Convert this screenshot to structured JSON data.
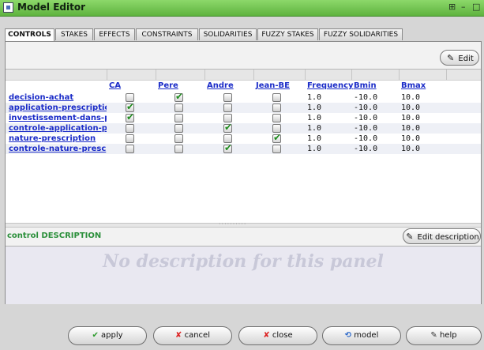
{
  "window": {
    "title": "Model Editor",
    "controls": [
      "⊞",
      "–",
      "□"
    ]
  },
  "tabs": [
    {
      "label": "CONTROLS",
      "active": true
    },
    {
      "label": "STAKES",
      "active": false
    },
    {
      "label": "EFFECTS",
      "active": false
    },
    {
      "label": "CONSTRAINTS",
      "active": false
    },
    {
      "label": "SOLIDARITIES",
      "active": false
    },
    {
      "label": "FUZZY STAKES",
      "active": false
    },
    {
      "label": "FUZZY SOLIDARITIES",
      "active": false
    }
  ],
  "toolbar": {
    "edit_label": "Edit"
  },
  "table": {
    "columns": [
      "CA",
      "Pere",
      "Andre",
      "Jean-BE",
      "Frequency",
      "Bmin",
      "Bmax"
    ],
    "rows": [
      {
        "name": "decision-achat",
        "checks": [
          false,
          true,
          false,
          false
        ],
        "frequency": "1.0",
        "bmin": "-10.0",
        "bmax": "10.0"
      },
      {
        "name": "application-prescription",
        "checks": [
          true,
          false,
          false,
          false
        ],
        "frequency": "1.0",
        "bmin": "-10.0",
        "bmax": "10.0"
      },
      {
        "name": "investissement-dans-pri",
        "checks": [
          true,
          false,
          false,
          false
        ],
        "frequency": "1.0",
        "bmin": "-10.0",
        "bmax": "10.0"
      },
      {
        "name": "controle-application-pre",
        "checks": [
          false,
          false,
          true,
          false
        ],
        "frequency": "1.0",
        "bmin": "-10.0",
        "bmax": "10.0"
      },
      {
        "name": "nature-prescription",
        "checks": [
          false,
          false,
          false,
          true
        ],
        "frequency": "1.0",
        "bmin": "-10.0",
        "bmax": "10.0"
      },
      {
        "name": "controle-nature-presc",
        "checks": [
          false,
          false,
          true,
          false
        ],
        "frequency": "1.0",
        "bmin": "-10.0",
        "bmax": "10.0"
      }
    ]
  },
  "description": {
    "label": "control DESCRIPTION",
    "edit_label": "Edit description",
    "placeholder": "No description for this panel"
  },
  "actions": [
    {
      "label": "apply",
      "icon": "checkmark-icon"
    },
    {
      "label": "cancel",
      "icon": "cross-icon"
    },
    {
      "label": "close",
      "icon": "cross-icon"
    },
    {
      "label": "model",
      "icon": "model-icon"
    },
    {
      "label": "help",
      "icon": "pencil-icon"
    }
  ],
  "colors": {
    "titlebar": "#6cc14a",
    "link": "#1b2cc8",
    "check": "#1e8b1e",
    "desc_label": "#2a8f3a"
  }
}
